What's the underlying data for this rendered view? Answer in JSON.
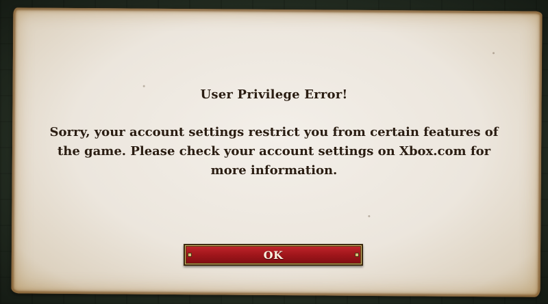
{
  "dialog": {
    "title": "User Privilege Error!",
    "message": "Sorry, your account settings restrict you from certain features of the game. Please check your account settings on Xbox.com for more information.",
    "ok_label": "OK"
  },
  "colors": {
    "parchment": "#ece6dd",
    "text": "#2a1d12",
    "button_red": "#a0161b",
    "button_text": "#fbf1e0"
  }
}
